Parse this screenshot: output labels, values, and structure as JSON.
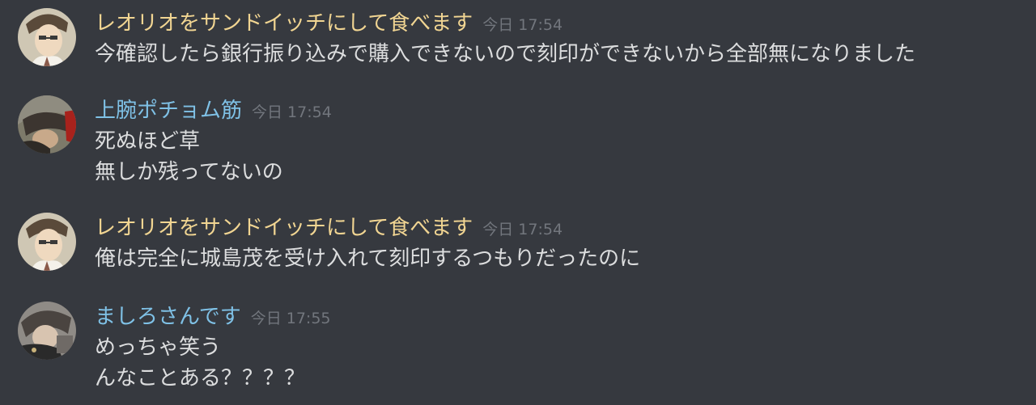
{
  "messages": [
    {
      "username": "レオリオをサンドイッチにして食べます",
      "username_color": "#f1d592",
      "timestamp": "今日 17:54",
      "avatar": "anime-character-avatar",
      "lines": [
        "今確認したら銀行振り込みで購入できないので刻印ができないから全部無になりました"
      ]
    },
    {
      "username": "上腕ポチョム筋",
      "username_color": "#7fc1e6",
      "timestamp": "今日 17:54",
      "avatar": "anime-character-avatar",
      "lines": [
        "死ぬほど草",
        "無しか残ってないの"
      ]
    },
    {
      "username": "レオリオをサンドイッチにして食べます",
      "username_color": "#f1d592",
      "timestamp": "今日 17:54",
      "avatar": "anime-character-avatar",
      "lines": [
        "俺は完全に城島茂を受け入れて刻印するつもりだったのに"
      ]
    },
    {
      "username": "ましろさんです",
      "username_color": "#7fc1e6",
      "timestamp": "今日 17:55",
      "avatar": "anime-character-avatar",
      "lines": [
        "めっちゃ笑う",
        "んなことある？？？？"
      ]
    }
  ]
}
